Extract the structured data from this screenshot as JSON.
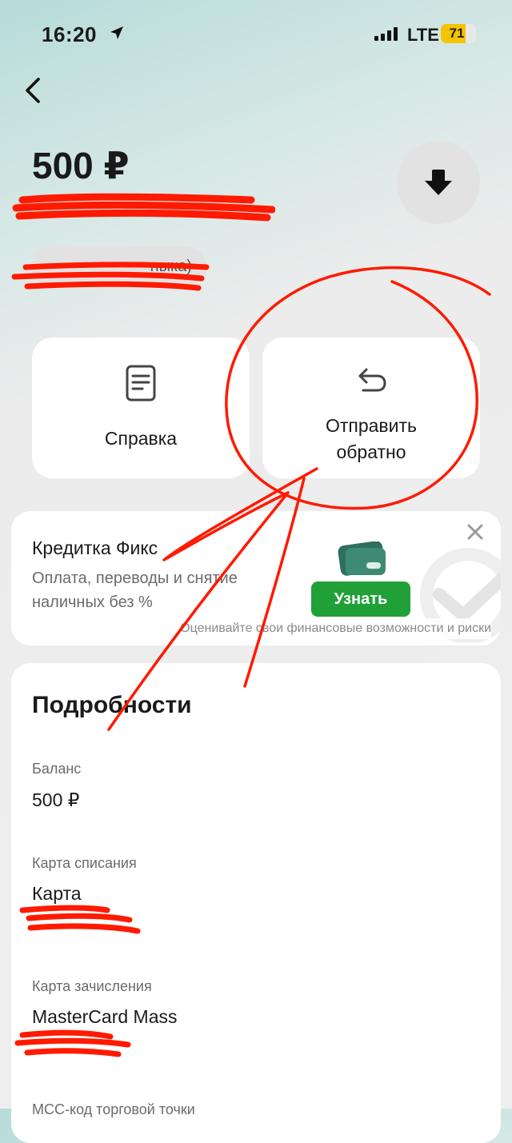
{
  "status_bar": {
    "time": "16:20",
    "network": "LTE",
    "battery_percent": "71",
    "battery_level": 0.71
  },
  "header": {
    "amount": "500 ₽",
    "back_icon": "chevron-left-icon",
    "download_icon": "download-arrow-icon",
    "pill_text_fragment": "ныка)"
  },
  "actions": [
    {
      "label": "Справка",
      "icon": "document-icon"
    },
    {
      "label": "Отправить\nобратно",
      "icon": "undo-arrow-icon"
    }
  ],
  "promo": {
    "title": "Кредитка Фикс",
    "text": "Оплата, переводы и снятие наличных без %",
    "button": "Узнать",
    "note": "Оценивайте свои финансовые возможности и риски",
    "accent": "#21a038"
  },
  "details": {
    "title": "Подробности",
    "fields": [
      {
        "label": "Баланс",
        "value": "500 ₽"
      },
      {
        "label": "Карта списания",
        "value": "Карта"
      },
      {
        "label": "Карта зачисления",
        "value": "MasterCard Mass"
      }
    ],
    "clipped_label": "MCC-код торговой точки"
  },
  "annotation_color": "#ff1a00"
}
